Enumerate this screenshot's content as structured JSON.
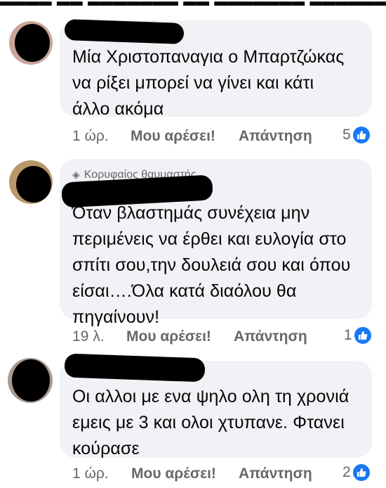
{
  "comments": [
    {
      "text_lines": [
        "Μία Χριστοπαναγια ο Μπαρτζώκας",
        "να ρίξει μπορεί να γίνει και κάτι",
        "άλλο ακόμα"
      ],
      "time": "1 ώρ.",
      "like_label": "Μου αρέσει!",
      "reply_label": "Απάντηση",
      "reaction_count": "5"
    },
    {
      "badge": "Κορυφαίος θαυμαστής",
      "text_lines": [
        "Όταν βλαστημάς συνέχεια μην",
        "περιμένεις να έρθει και ευλογία στο",
        "σπίτι σου,την δουλειά σου και όπου",
        "είσαι….Όλα κατά διαόλου θα",
        "πηγαίνουν!"
      ],
      "time": "19 λ.",
      "like_label": "Μου αρέσει!",
      "reply_label": "Απάντηση",
      "reaction_count": "1"
    },
    {
      "text_lines": [
        "Οι αλλοι με ενα ψηλο ολη τη χρονιά",
        "εμεις με 3 και ολοι χτυπανε. Φτανει",
        "κούρασε"
      ],
      "time": "1 ώρ.",
      "like_label": "Μου αρέσει!",
      "reply_label": "Απάντηση",
      "reaction_count": "2"
    }
  ],
  "colors": {
    "bubble": "#f0f2f5",
    "meta_text": "#65676b",
    "like_blue": "#1877f2"
  },
  "icons": [
    "like-thumb-icon",
    "diamond-badge-icon"
  ]
}
